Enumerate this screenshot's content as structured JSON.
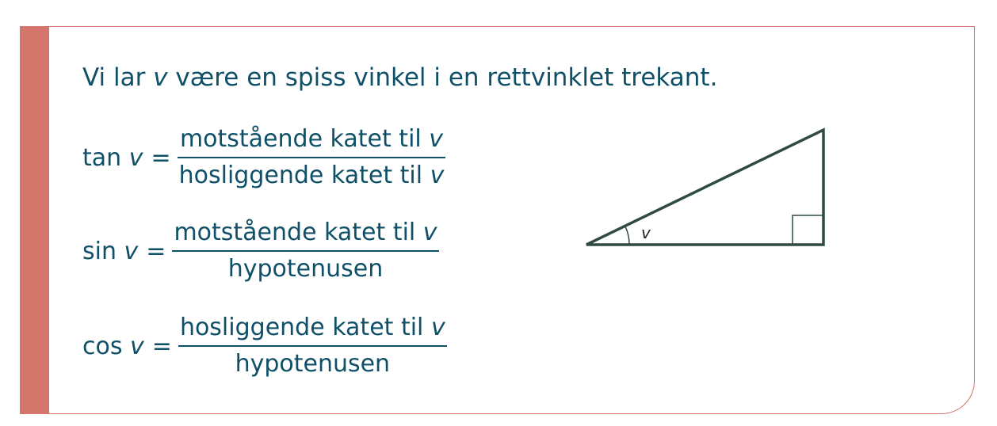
{
  "intro": {
    "before": "Vi lar ",
    "var": "v",
    "after": " være en spiss vinkel i en rettvinklet trekant."
  },
  "formulas": [
    {
      "func": "tan",
      "var": "v",
      "eq": "=",
      "numerator": "motstående katet til",
      "numerator_var": "v",
      "denominator": "hosliggende katet til",
      "denominator_var": "v"
    },
    {
      "func": "sin",
      "var": "v",
      "eq": "=",
      "numerator": "motstående katet til",
      "numerator_var": "v",
      "denominator": "hypotenusen",
      "denominator_var": ""
    },
    {
      "func": "cos",
      "var": "v",
      "eq": "=",
      "numerator": "hosliggende katet til",
      "numerator_var": "v",
      "denominator": "hypotenusen",
      "denominator_var": ""
    }
  ],
  "triangle": {
    "angle_label": "v"
  },
  "colors": {
    "accent_bar": "#d4766c",
    "text": "#0f5068",
    "triangle_stroke": "#2f4a42"
  }
}
